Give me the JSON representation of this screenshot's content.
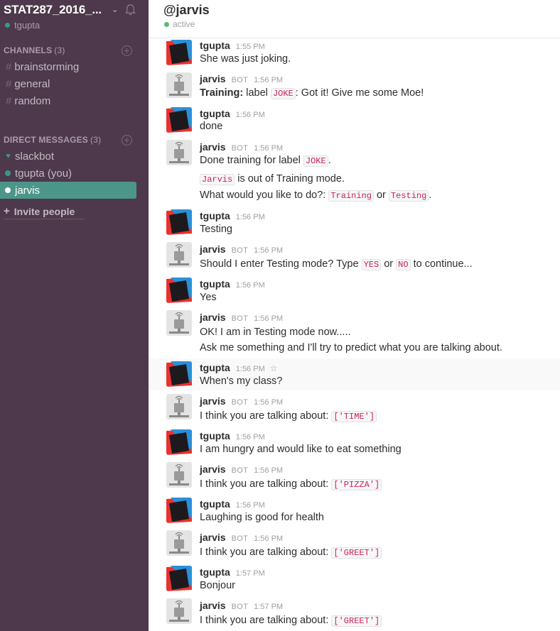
{
  "sidebar": {
    "team_name": "STAT287_2016_...",
    "user": "tgupta",
    "channels_header": "CHANNELS",
    "channels_count": "(3)",
    "channels": [
      "brainstorming",
      "general",
      "random"
    ],
    "dms_header": "DIRECT MESSAGES",
    "dms_count": "(3)",
    "dms": [
      "slackbot",
      "tgupta (you)",
      "jarvis"
    ],
    "invite": "Invite people"
  },
  "header": {
    "title": "@jarvis",
    "status": "active"
  },
  "messages": [
    {
      "author": "tgupta",
      "time": "1:55 PM",
      "l1": "She was just joking."
    },
    {
      "author": "jarvis",
      "bot": "BOT",
      "time": "1:56 PM",
      "p1": "Training:",
      "p2": " label ",
      "c1": "JOKE",
      "p3": ": Got it! Give me some Moe!"
    },
    {
      "author": "tgupta",
      "time": "1:56 PM",
      "l1": "done"
    },
    {
      "author": "jarvis",
      "bot": "BOT",
      "time": "1:56 PM",
      "p1": "Done training for label ",
      "c1": "JOKE",
      "p2": ".",
      "c2": "Jarvis",
      "p3": " is out of Training mode.",
      "p4": "What would you like to do?: ",
      "c3": "Training",
      "p5": " or ",
      "c4": "Testing",
      "p6": "."
    },
    {
      "author": "tgupta",
      "time": "1:56 PM",
      "l1": "Testing"
    },
    {
      "author": "jarvis",
      "bot": "BOT",
      "time": "1:56 PM",
      "p1": "Should I enter Testing mode? Type ",
      "c1": "YES",
      "p2": " or ",
      "c2": "NO",
      "p3": " to continue..."
    },
    {
      "author": "tgupta",
      "time": "1:56 PM",
      "l1": "Yes"
    },
    {
      "author": "jarvis",
      "bot": "BOT",
      "time": "1:56 PM",
      "l1": "OK! I am in Testing mode now.....",
      "l2": "Ask me something and I'll try to predict what you are talking about."
    },
    {
      "author": "tgupta",
      "time": "1:56 PM",
      "l1": "When's my class?"
    },
    {
      "author": "jarvis",
      "bot": "BOT",
      "time": "1:56 PM",
      "p1": "I think you are talking about: ",
      "c1": "['TIME']"
    },
    {
      "author": "tgupta",
      "time": "1:56 PM",
      "l1": "I am hungry and would like to eat something"
    },
    {
      "author": "jarvis",
      "bot": "BOT",
      "time": "1:56 PM",
      "p1": "I think you are talking about: ",
      "c1": "['PIZZA']"
    },
    {
      "author": "tgupta",
      "time": "1:56 PM",
      "l1": "Laughing is good for health"
    },
    {
      "author": "jarvis",
      "bot": "BOT",
      "time": "1:56 PM",
      "p1": "I think you are talking about: ",
      "c1": "['GREET']"
    },
    {
      "author": "tgupta",
      "time": "1:57 PM",
      "l1": "Bonjour"
    },
    {
      "author": "jarvis",
      "bot": "BOT",
      "time": "1:57 PM",
      "p1": "I think you are talking about: ",
      "c1": "['GREET']"
    }
  ]
}
